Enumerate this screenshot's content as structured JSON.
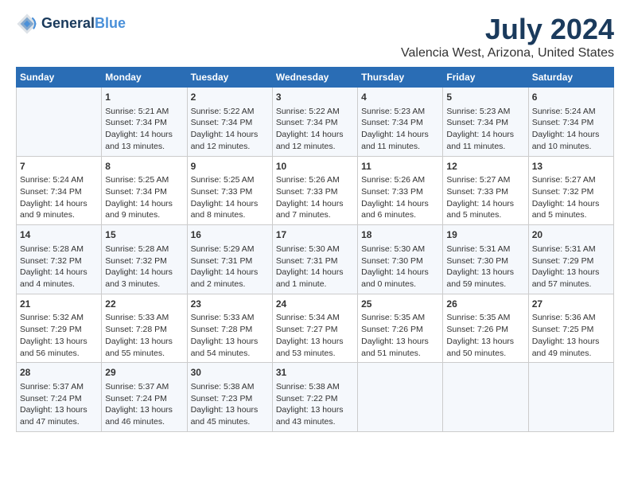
{
  "header": {
    "logo_line1": "General",
    "logo_line2": "Blue",
    "title": "July 2024",
    "subtitle": "Valencia West, Arizona, United States"
  },
  "columns": [
    "Sunday",
    "Monday",
    "Tuesday",
    "Wednesday",
    "Thursday",
    "Friday",
    "Saturday"
  ],
  "weeks": [
    [
      {
        "date": "",
        "info": ""
      },
      {
        "date": "1",
        "info": "Sunrise: 5:21 AM\nSunset: 7:34 PM\nDaylight: 14 hours\nand 13 minutes."
      },
      {
        "date": "2",
        "info": "Sunrise: 5:22 AM\nSunset: 7:34 PM\nDaylight: 14 hours\nand 12 minutes."
      },
      {
        "date": "3",
        "info": "Sunrise: 5:22 AM\nSunset: 7:34 PM\nDaylight: 14 hours\nand 12 minutes."
      },
      {
        "date": "4",
        "info": "Sunrise: 5:23 AM\nSunset: 7:34 PM\nDaylight: 14 hours\nand 11 minutes."
      },
      {
        "date": "5",
        "info": "Sunrise: 5:23 AM\nSunset: 7:34 PM\nDaylight: 14 hours\nand 11 minutes."
      },
      {
        "date": "6",
        "info": "Sunrise: 5:24 AM\nSunset: 7:34 PM\nDaylight: 14 hours\nand 10 minutes."
      }
    ],
    [
      {
        "date": "7",
        "info": "Sunrise: 5:24 AM\nSunset: 7:34 PM\nDaylight: 14 hours\nand 9 minutes."
      },
      {
        "date": "8",
        "info": "Sunrise: 5:25 AM\nSunset: 7:34 PM\nDaylight: 14 hours\nand 9 minutes."
      },
      {
        "date": "9",
        "info": "Sunrise: 5:25 AM\nSunset: 7:33 PM\nDaylight: 14 hours\nand 8 minutes."
      },
      {
        "date": "10",
        "info": "Sunrise: 5:26 AM\nSunset: 7:33 PM\nDaylight: 14 hours\nand 7 minutes."
      },
      {
        "date": "11",
        "info": "Sunrise: 5:26 AM\nSunset: 7:33 PM\nDaylight: 14 hours\nand 6 minutes."
      },
      {
        "date": "12",
        "info": "Sunrise: 5:27 AM\nSunset: 7:33 PM\nDaylight: 14 hours\nand 5 minutes."
      },
      {
        "date": "13",
        "info": "Sunrise: 5:27 AM\nSunset: 7:32 PM\nDaylight: 14 hours\nand 5 minutes."
      }
    ],
    [
      {
        "date": "14",
        "info": "Sunrise: 5:28 AM\nSunset: 7:32 PM\nDaylight: 14 hours\nand 4 minutes."
      },
      {
        "date": "15",
        "info": "Sunrise: 5:28 AM\nSunset: 7:32 PM\nDaylight: 14 hours\nand 3 minutes."
      },
      {
        "date": "16",
        "info": "Sunrise: 5:29 AM\nSunset: 7:31 PM\nDaylight: 14 hours\nand 2 minutes."
      },
      {
        "date": "17",
        "info": "Sunrise: 5:30 AM\nSunset: 7:31 PM\nDaylight: 14 hours\nand 1 minute."
      },
      {
        "date": "18",
        "info": "Sunrise: 5:30 AM\nSunset: 7:30 PM\nDaylight: 14 hours\nand 0 minutes."
      },
      {
        "date": "19",
        "info": "Sunrise: 5:31 AM\nSunset: 7:30 PM\nDaylight: 13 hours\nand 59 minutes."
      },
      {
        "date": "20",
        "info": "Sunrise: 5:31 AM\nSunset: 7:29 PM\nDaylight: 13 hours\nand 57 minutes."
      }
    ],
    [
      {
        "date": "21",
        "info": "Sunrise: 5:32 AM\nSunset: 7:29 PM\nDaylight: 13 hours\nand 56 minutes."
      },
      {
        "date": "22",
        "info": "Sunrise: 5:33 AM\nSunset: 7:28 PM\nDaylight: 13 hours\nand 55 minutes."
      },
      {
        "date": "23",
        "info": "Sunrise: 5:33 AM\nSunset: 7:28 PM\nDaylight: 13 hours\nand 54 minutes."
      },
      {
        "date": "24",
        "info": "Sunrise: 5:34 AM\nSunset: 7:27 PM\nDaylight: 13 hours\nand 53 minutes."
      },
      {
        "date": "25",
        "info": "Sunrise: 5:35 AM\nSunset: 7:26 PM\nDaylight: 13 hours\nand 51 minutes."
      },
      {
        "date": "26",
        "info": "Sunrise: 5:35 AM\nSunset: 7:26 PM\nDaylight: 13 hours\nand 50 minutes."
      },
      {
        "date": "27",
        "info": "Sunrise: 5:36 AM\nSunset: 7:25 PM\nDaylight: 13 hours\nand 49 minutes."
      }
    ],
    [
      {
        "date": "28",
        "info": "Sunrise: 5:37 AM\nSunset: 7:24 PM\nDaylight: 13 hours\nand 47 minutes."
      },
      {
        "date": "29",
        "info": "Sunrise: 5:37 AM\nSunset: 7:24 PM\nDaylight: 13 hours\nand 46 minutes."
      },
      {
        "date": "30",
        "info": "Sunrise: 5:38 AM\nSunset: 7:23 PM\nDaylight: 13 hours\nand 45 minutes."
      },
      {
        "date": "31",
        "info": "Sunrise: 5:38 AM\nSunset: 7:22 PM\nDaylight: 13 hours\nand 43 minutes."
      },
      {
        "date": "",
        "info": ""
      },
      {
        "date": "",
        "info": ""
      },
      {
        "date": "",
        "info": ""
      }
    ]
  ]
}
